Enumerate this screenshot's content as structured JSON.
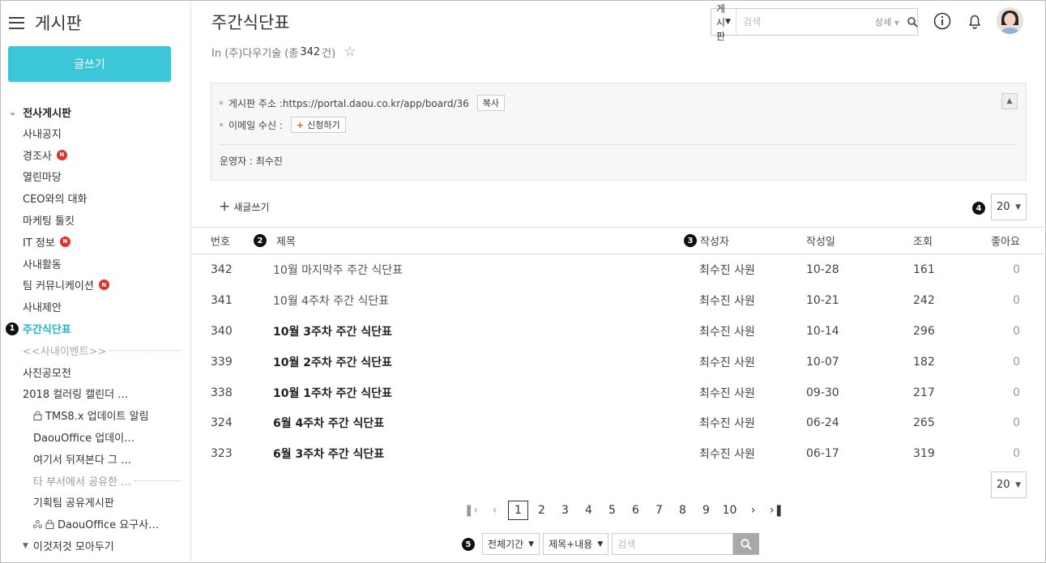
{
  "sidebar": {
    "title": "게시판",
    "write_label": "글쓰기",
    "group_label": "전사게시판",
    "items": [
      {
        "label": "사내공지",
        "badge": ""
      },
      {
        "label": "경조사",
        "badge": "N"
      },
      {
        "label": "열린마당",
        "badge": ""
      },
      {
        "label": "CEO와의 대화",
        "badge": ""
      },
      {
        "label": "마케팅 툴킷",
        "badge": ""
      },
      {
        "label": "IT 정보",
        "badge": "N"
      },
      {
        "label": "사내활동",
        "badge": ""
      },
      {
        "label": "팀 커뮤니케이션",
        "badge": "N"
      },
      {
        "label": "사내제안",
        "badge": ""
      },
      {
        "label": "주간식단표",
        "badge": ""
      },
      {
        "label": "<<사내이벤트>>",
        "badge": ""
      },
      {
        "label": "사진공모전",
        "badge": ""
      },
      {
        "label": "2018 컬러링 캘린더 …",
        "badge": ""
      }
    ],
    "sub_items": [
      {
        "label": "TMS8.x 업데이트 알림"
      },
      {
        "label": "DaouOffice 업데이…"
      },
      {
        "label": "여기서 뒤져본다 그 …"
      },
      {
        "label": "타 부서에서 공유한 …"
      },
      {
        "label": "기획팀 공유게시판"
      },
      {
        "label": "DaouOffice 요구사…"
      }
    ],
    "collapsed_group": "이것저것 모아두기",
    "active_marker": "1"
  },
  "header": {
    "title": "주간식단표",
    "subline_prefix": "In (주)다우기술 (총",
    "count": "342",
    "subline_suffix": "건)",
    "search": {
      "scope": "게시판",
      "placeholder": "검색",
      "detail_label": "상세"
    }
  },
  "info": {
    "address_label": "게시판 주소 :https://portal.daou.co.kr/app/board/36",
    "copy_label": "복사",
    "email_label": "이메일 수신 :",
    "subscribe_label": "신청하기",
    "operator_label": "운영자 : 최수진"
  },
  "toolbar": {
    "new_post_label": "새글쓰기",
    "page_size": "20",
    "page_size_marker": "4"
  },
  "table": {
    "headers": {
      "no": "번호",
      "title": "제목",
      "author": "작성자",
      "date": "작성일",
      "views": "조회",
      "likes": "좋아요"
    },
    "title_marker": "2",
    "author_marker": "3",
    "rows": [
      {
        "no": "342",
        "title": "10월 마지막주 주간 식단표",
        "author": "최수진 사원",
        "date": "10-28",
        "views": "161",
        "likes": "0",
        "bold": false
      },
      {
        "no": "341",
        "title": "10월 4주차 주간 식단표",
        "author": "최수진 사원",
        "date": "10-21",
        "views": "242",
        "likes": "0",
        "bold": false
      },
      {
        "no": "340",
        "title": "10월 3주차 주간 식단표",
        "author": "최수진 사원",
        "date": "10-14",
        "views": "296",
        "likes": "0",
        "bold": true
      },
      {
        "no": "339",
        "title": "10월 2주차 주간 식단표",
        "author": "최수진 사원",
        "date": "10-07",
        "views": "182",
        "likes": "0",
        "bold": true
      },
      {
        "no": "338",
        "title": "10월 1주차 주간 식단표",
        "author": "최수진 사원",
        "date": "09-30",
        "views": "217",
        "likes": "0",
        "bold": true
      },
      {
        "no": "324",
        "title": "6월 4주차 주간 식단표",
        "author": "최수진 사원",
        "date": "06-24",
        "views": "265",
        "likes": "0",
        "bold": true
      },
      {
        "no": "323",
        "title": "6월 3주차 주간 식단표",
        "author": "최수진 사원",
        "date": "06-17",
        "views": "319",
        "likes": "0",
        "bold": true
      }
    ]
  },
  "pagination": {
    "pages": [
      "1",
      "2",
      "3",
      "4",
      "5",
      "6",
      "7",
      "8",
      "9",
      "10"
    ],
    "current": "1",
    "bottom_page_size": "20"
  },
  "bottom_search": {
    "marker": "5",
    "period": "전체기간",
    "field": "제목+내용",
    "placeholder": "검색"
  },
  "colors": {
    "accent": "#3cc7d9",
    "active_nav": "#1fb4c8",
    "badge_red": "#e0322b"
  }
}
